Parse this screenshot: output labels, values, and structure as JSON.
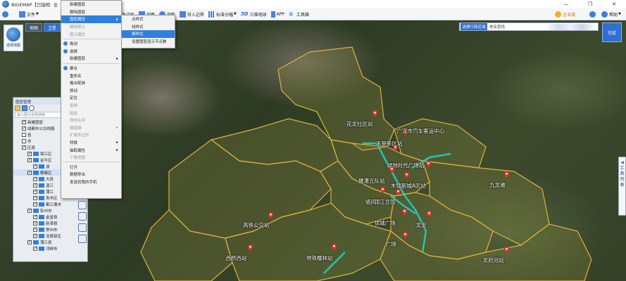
{
  "window": {
    "title": "BIGEMAP【已授权: 全",
    "controls": [
      "—",
      "❐",
      "✕"
    ]
  },
  "toolbar": {
    "items": [
      {
        "label": "文件",
        "icon": "file-icon"
      },
      {
        "label": "剖面",
        "icon": "profile-icon"
      },
      {
        "label": "多边形",
        "icon": "polygon-icon"
      },
      {
        "label": "测距",
        "icon": "ruler-icon"
      },
      {
        "label": "标注",
        "icon": "mark-icon"
      },
      {
        "label": "导入边界",
        "icon": "boundary-icon"
      },
      {
        "label": "标准分幅",
        "icon": "grid-icon"
      },
      {
        "label": "三维地球",
        "icon": "3d-icon"
      },
      {
        "label": "APP",
        "icon": "app-icon"
      },
      {
        "label": "工具箱",
        "icon": "toolbox-icon"
      }
    ],
    "enterprise_label": "企业版",
    "help_label": "帮助"
  },
  "brand": {
    "label": "选择地图"
  },
  "map_tabs": [
    {
      "label": "地图",
      "active": false
    },
    {
      "label": "卫星",
      "active": true
    }
  ],
  "region_search": {
    "select_label": "选择行政区域",
    "input_placeholder": "地名查找"
  },
  "finish_button": "完成",
  "side_tool": {
    "chars": [
      "工",
      "具",
      "列",
      "表"
    ]
  },
  "layer_panel": {
    "title": "图层管理",
    "search_placeholder": "输入图元名称搜索",
    "tree": [
      {
        "label": "新建图层",
        "checked": true,
        "indent": 1,
        "folder": false
      },
      {
        "label": "成都市公交线路",
        "checked": true,
        "indent": 1,
        "folder": false
      },
      {
        "label": "省",
        "checked": false,
        "indent": 1,
        "folder": false
      },
      {
        "label": "市",
        "checked": false,
        "indent": 1,
        "folder": false
      },
      {
        "label": "区县",
        "checked": true,
        "indent": 1,
        "folder": false
      },
      {
        "label": "锦江区",
        "checked": true,
        "indent": 2,
        "folder": true
      },
      {
        "label": "金牛区",
        "checked": true,
        "indent": 2,
        "folder": true
      },
      {
        "label": "波",
        "checked": true,
        "indent": 3,
        "folder": true
      },
      {
        "label": "郫都区",
        "checked": true,
        "indent": 2,
        "folder": true,
        "selected": true
      },
      {
        "label": "大邑",
        "checked": true,
        "indent": 3,
        "folder": true
      },
      {
        "label": "温江",
        "checked": true,
        "indent": 3,
        "folder": true
      },
      {
        "label": "蒲江",
        "checked": true,
        "indent": 3,
        "folder": true
      },
      {
        "label": "青羊区",
        "checked": true,
        "indent": 3,
        "folder": true
      },
      {
        "label": "都江堰市",
        "checked": true,
        "indent": 3,
        "folder": true
      },
      {
        "label": "彭州市",
        "checked": true,
        "indent": 2,
        "folder": true
      },
      {
        "label": "金堂县",
        "checked": true,
        "indent": 3,
        "folder": true
      },
      {
        "label": "新津县",
        "checked": true,
        "indent": 3,
        "folder": true
      },
      {
        "label": "崇州市",
        "checked": true,
        "indent": 3,
        "folder": true
      },
      {
        "label": "龙泉驿区",
        "checked": true,
        "indent": 3,
        "folder": true
      },
      {
        "label": "蒲江县",
        "checked": true,
        "indent": 2,
        "folder": true
      },
      {
        "label": "邛崃市",
        "checked": true,
        "indent": 3,
        "folder": true
      }
    ]
  },
  "context_menu": {
    "items": [
      {
        "label": "新建图层",
        "disabled": false
      },
      {
        "label": "删除图层",
        "disabled": false
      },
      {
        "label": "图层属性",
        "disabled": false,
        "highlight": true,
        "submenu": true
      },
      {
        "label": "删除图元",
        "disabled": true
      },
      {
        "label": "图元属性",
        "disabled": true
      },
      {
        "sep": true
      },
      {
        "label": "拖动",
        "disabled": false,
        "icon": true
      },
      {
        "label": "选择",
        "disabled": false,
        "icon": true
      },
      {
        "label": "新建图层",
        "disabled": false,
        "submenu": true
      },
      {
        "sep": true
      },
      {
        "label": "聚合",
        "disabled": false,
        "icon": true
      },
      {
        "label": "重命名",
        "disabled": false
      },
      {
        "label": "複合配准",
        "disabled": false
      },
      {
        "label": "移动",
        "disabled": false
      },
      {
        "label": "定位",
        "disabled": false
      },
      {
        "label": "复制",
        "disabled": true
      },
      {
        "label": "粘贴",
        "disabled": true
      },
      {
        "label": "两线合并",
        "disabled": true
      },
      {
        "label": "填缝镶",
        "disabled": true,
        "submenu": true
      },
      {
        "label": "扩展多边形",
        "disabled": true
      },
      {
        "label": "转换",
        "disabled": false,
        "submenu": true
      },
      {
        "label": "抽取属性",
        "disabled": false,
        "submenu": true
      },
      {
        "label": "下载地图",
        "disabled": true
      },
      {
        "sep": true
      },
      {
        "label": "打开",
        "disabled": false
      },
      {
        "label": "数据导出",
        "disabled": false
      },
      {
        "label": "发送到我的手机",
        "disabled": false
      }
    ]
  },
  "submenu": {
    "items": [
      {
        "label": "点样式",
        "highlight": false
      },
      {
        "label": "线样式",
        "highlight": false
      },
      {
        "label": "面样式",
        "highlight": true
      },
      {
        "label": "设置图层显示节点数",
        "highlight": false
      }
    ]
  },
  "pois": [
    {
      "label": "花龙社区站"
    },
    {
      "label": "广汉市汽车客运中心"
    },
    {
      "label": "禾登新区站"
    },
    {
      "label": "绿地时代广场站"
    },
    {
      "label": "雒漕五队站"
    },
    {
      "label": "木锦新城A区站"
    },
    {
      "label": "九龙滩"
    },
    {
      "label": "锦江豆馆"
    },
    {
      "label": "墙风"
    },
    {
      "label": "锦城广场"
    },
    {
      "label": "高铁公交站"
    },
    {
      "label": "龙安"
    },
    {
      "label": "广场"
    },
    {
      "label": "西桥西站"
    },
    {
      "label": "地铁樱林站"
    },
    {
      "label": "龙府河站"
    }
  ],
  "colors": {
    "accent": "#2f7fe0",
    "boundary": "#e0b23a",
    "pin": "#d33"
  }
}
